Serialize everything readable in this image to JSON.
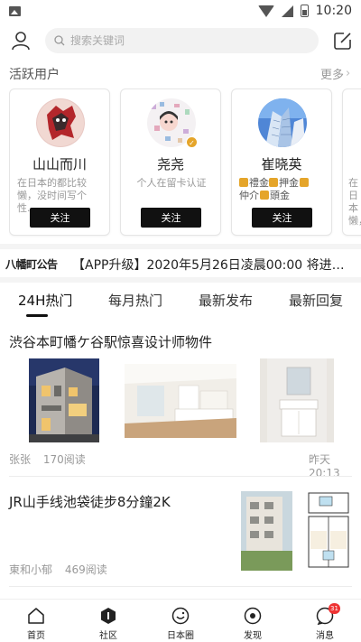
{
  "status_bar": {
    "time": "10:20"
  },
  "search": {
    "placeholder": "搜索关键词"
  },
  "active_users": {
    "title": "活跃用户",
    "more_label": "更多",
    "follow_label": "关注",
    "users": [
      {
        "name": "山山而川",
        "desc": "在日本的都比较懒，没时间写个性..."
      },
      {
        "name": "尧尧",
        "desc": "个人在留卡认证"
      },
      {
        "name": "崔晓英",
        "tags": [
          "禮金",
          "押金",
          "仲介",
          "頭金"
        ]
      },
      {
        "name": "",
        "desc": "在日本懒，"
      }
    ]
  },
  "notice": {
    "logo": "八幡町公告",
    "text": "【APP升级】2020年5月26日凌晨00:00 将进行..."
  },
  "tabs": [
    "24H热门",
    "每月热门",
    "最新发布",
    "最新回复"
  ],
  "posts": [
    {
      "title": "渋谷本町幡ケ谷駅惊喜设计师物件",
      "author": "张张",
      "reads": "170阅读",
      "time": "昨天20:13"
    },
    {
      "title": "JR山手线池袋徒步8分鐘2K",
      "author": "東和小郁",
      "reads": "469阅读"
    }
  ],
  "bottom_nav": [
    {
      "label": "首页",
      "icon": "home-icon"
    },
    {
      "label": "社区",
      "icon": "community-icon"
    },
    {
      "label": "日本圈",
      "icon": "japan-circle-icon"
    },
    {
      "label": "发现",
      "icon": "discover-icon"
    },
    {
      "label": "消息",
      "icon": "message-icon",
      "badge": "31"
    }
  ],
  "colors": {
    "accent": "#111111",
    "badge": "#e33333",
    "gold": "#e5a52a"
  }
}
